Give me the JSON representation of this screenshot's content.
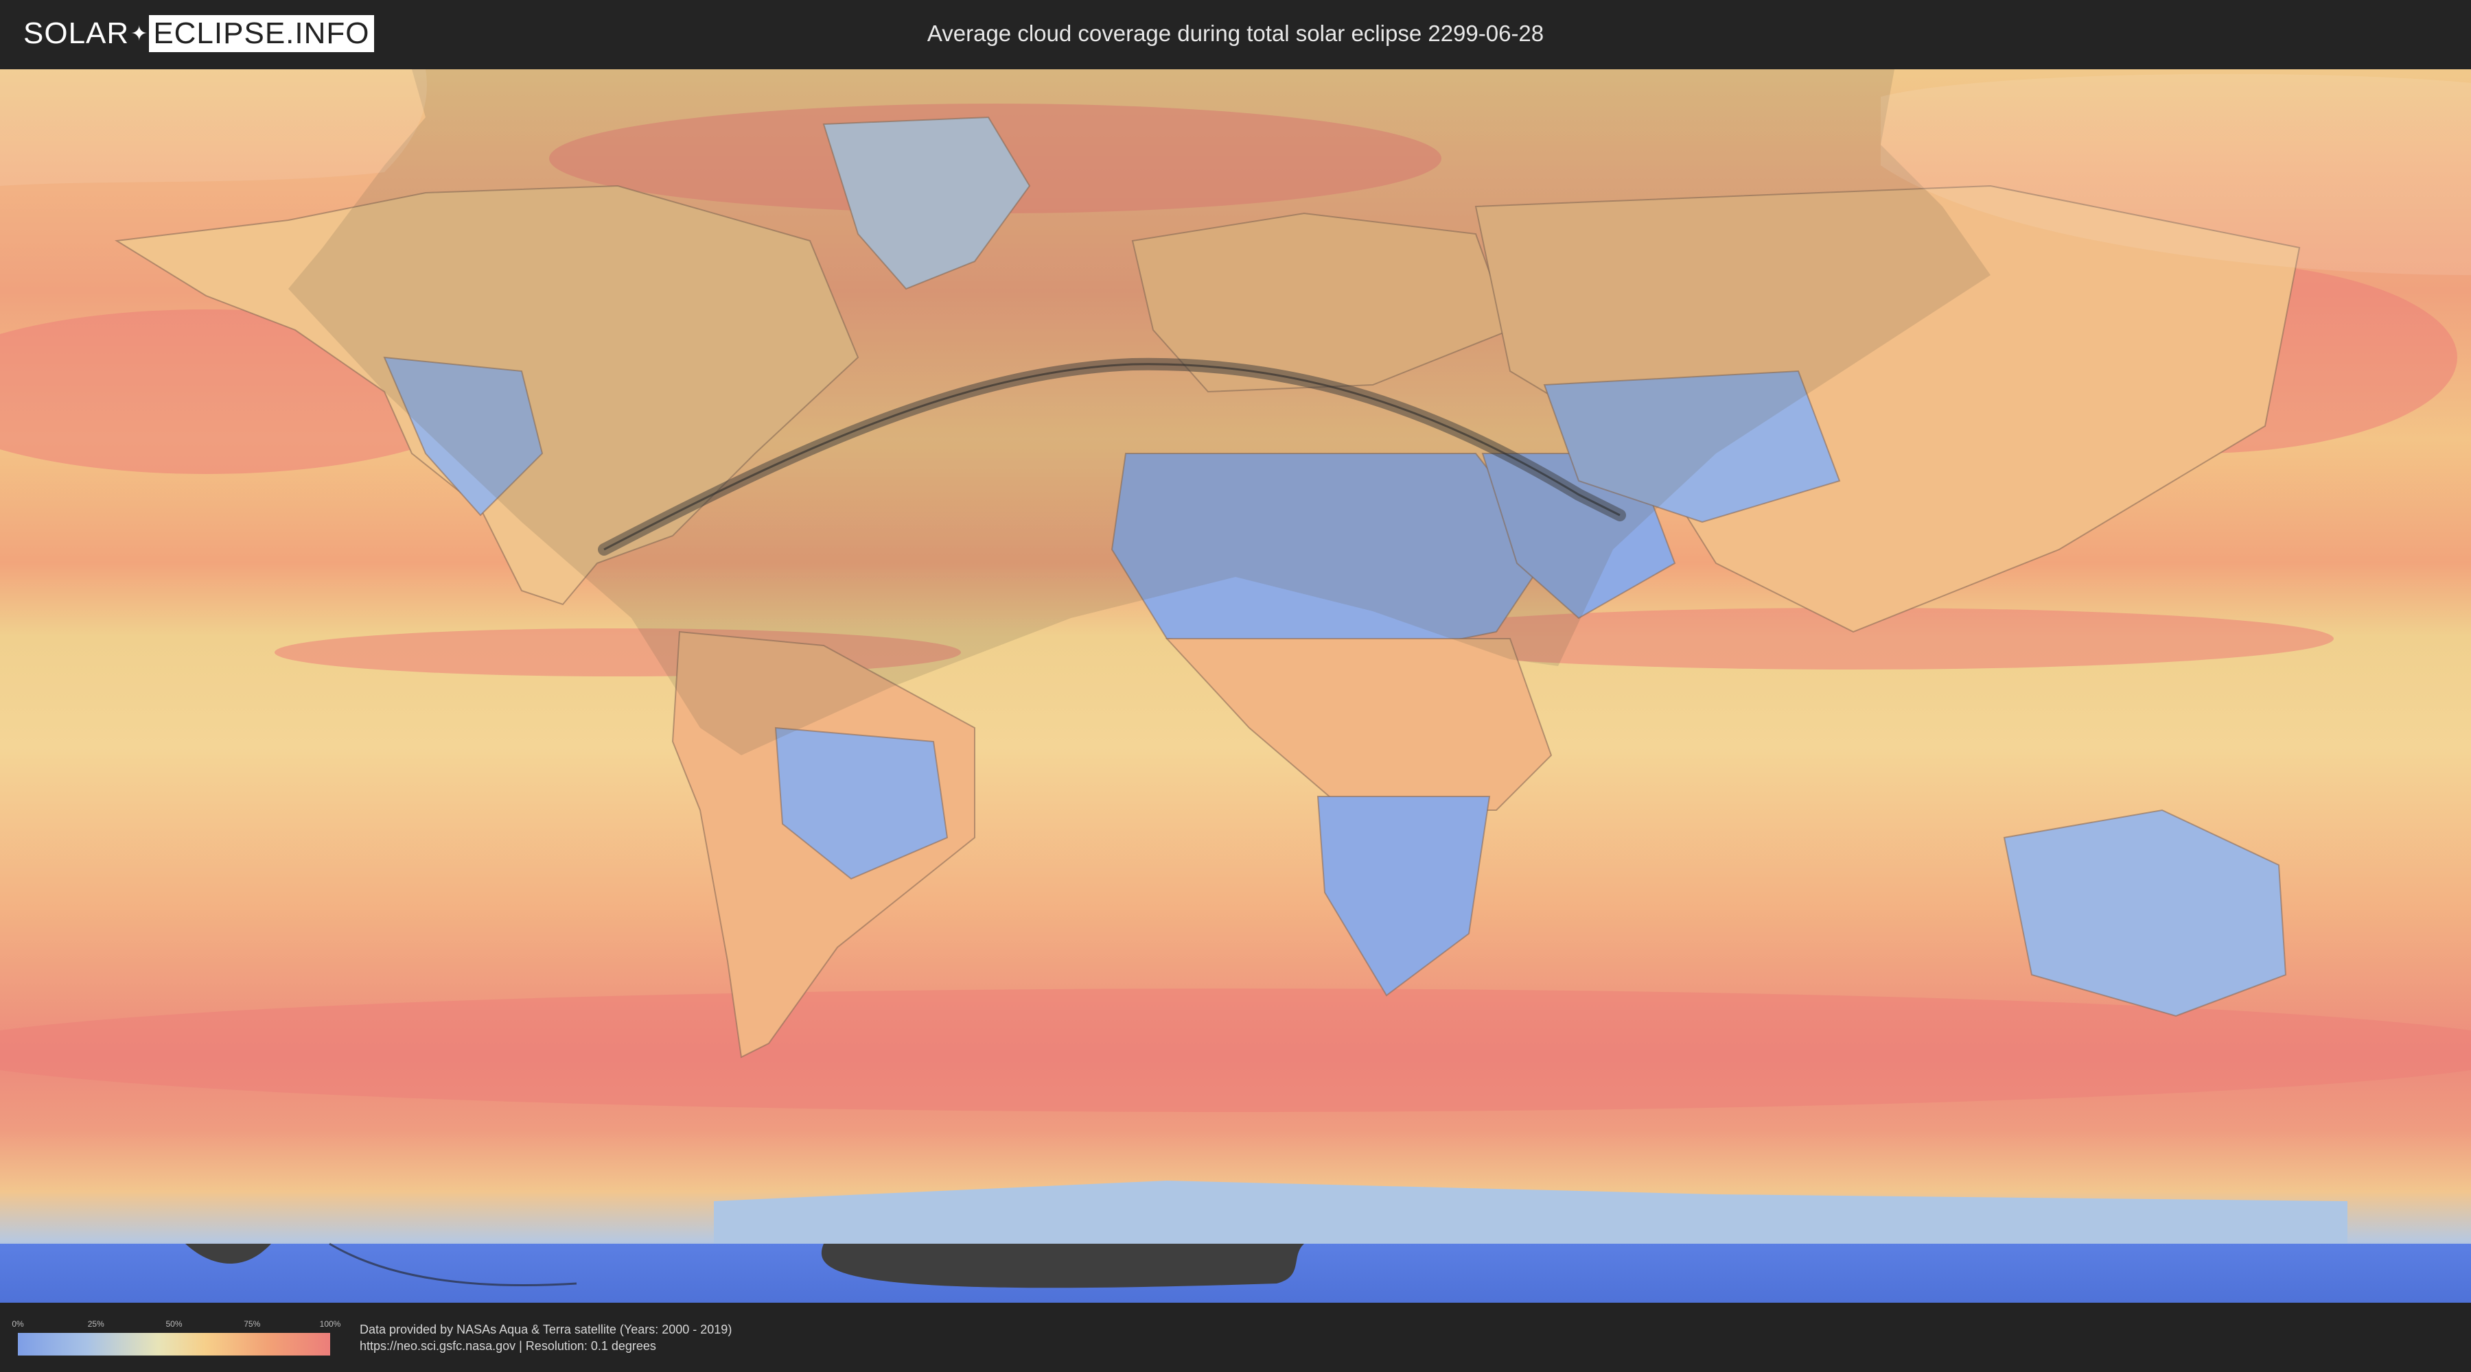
{
  "header": {
    "logo_left": "SOLAR",
    "logo_right": "ECLIPSE.INFO",
    "title": "Average cloud coverage during total solar eclipse 2299-06-28"
  },
  "map": {
    "layer": "average cloud coverage",
    "colors": {
      "clear": "#7e9ee6",
      "low": "#a8c2e6",
      "mid": "#f2d68e",
      "high": "#ec7e7a",
      "polar_blue": "#5b7fe3",
      "penumbra_shade": "#6a5e46",
      "totality_path": "#3a3a3a"
    }
  },
  "legend": {
    "ticks": [
      "0%",
      "25%",
      "50%",
      "75%",
      "100%"
    ],
    "tick_fractions": [
      0,
      0.25,
      0.5,
      0.75,
      1.0
    ]
  },
  "credits": {
    "line1": "Data provided by NASAs Aqua & Terra satellite (Years: 2000 - 2019)",
    "line2": "https://neo.sci.gsfc.nasa.gov | Resolution: 0.1 degrees"
  }
}
